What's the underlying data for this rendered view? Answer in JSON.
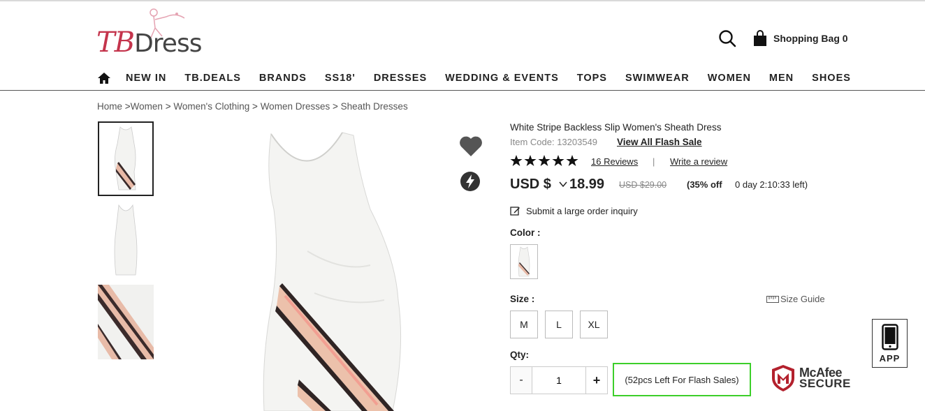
{
  "header": {
    "logo": {
      "text_main": "TB",
      "text_tail": "Dress"
    },
    "search_icon": "search-icon",
    "bag_label": "Shopping Bag 0"
  },
  "nav": {
    "home_icon": "home-icon",
    "items": [
      "NEW IN",
      "TB.DEALS",
      "BRANDS",
      "SS18'",
      "DRESSES",
      "WEDDING & EVENTS",
      "TOPS",
      "SWIMWEAR",
      "WOMEN",
      "MEN",
      "SHOES"
    ]
  },
  "breadcrumb": {
    "items": [
      "Home",
      "Women",
      "Women's Clothing",
      "Women Dresses",
      "Sheath Dresses"
    ],
    "separator": ">"
  },
  "product": {
    "title": "White Stripe Backless Slip Women's Sheath Dress",
    "item_code_label": "Item Code: 13203549",
    "flash_sale_link": "View All Flash Sale",
    "rating_stars": 5,
    "reviews_link": "16 Reviews",
    "separator": "|",
    "write_review_link": "Write a review",
    "currency": "USD $",
    "price": "18.99",
    "old_price": "USD $29.00",
    "discount": "(35% off",
    "countdown": "0 day 2:10:33 left)",
    "inquiry": "Submit a large order inquiry",
    "color_label": "Color :",
    "size_label": "Size :",
    "size_guide": "Size Guide",
    "sizes": [
      "M",
      "L",
      "XL"
    ],
    "qty_label": "Qty:",
    "qty_minus": "-",
    "qty_value": "1",
    "qty_plus": "+",
    "stock_note": "(52pcs Left For Flash Sales)"
  },
  "badges": {
    "mcafee_name": "McAfee",
    "mcafee_secure": "SECURE",
    "app_label": "APP"
  },
  "colors": {
    "brand": "#c4344c",
    "highlight_border": "#3ccf2a",
    "text": "#222222"
  }
}
